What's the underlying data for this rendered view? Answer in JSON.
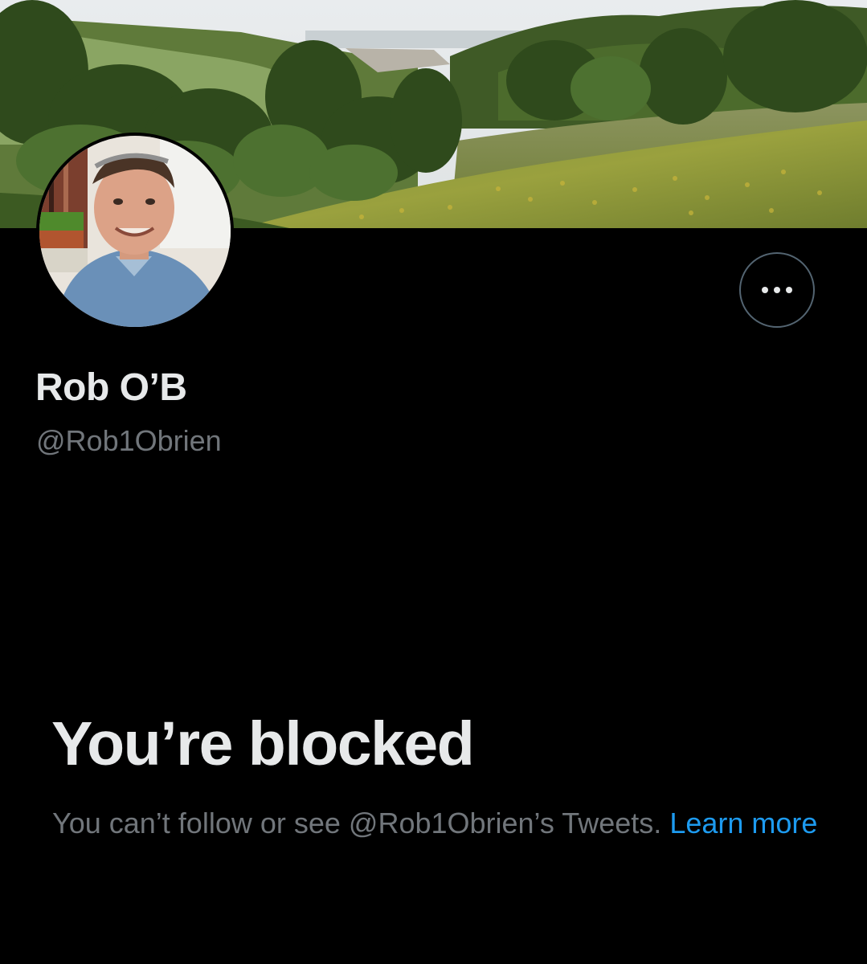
{
  "profile": {
    "display_name": "Rob O’B",
    "handle": "@Rob1Obrien"
  },
  "header_actions": {
    "more_icon": "more-horizontal-icon"
  },
  "blocked_notice": {
    "title": "You’re blocked",
    "message": "You can’t follow or see @Rob1Obrien’s Tweets.",
    "learn_more_label": "Learn more"
  },
  "colors": {
    "background": "#000000",
    "primary_text": "#e7e9ea",
    "secondary_text": "#71767b",
    "link": "#1d9bf0",
    "button_border": "#536471"
  }
}
